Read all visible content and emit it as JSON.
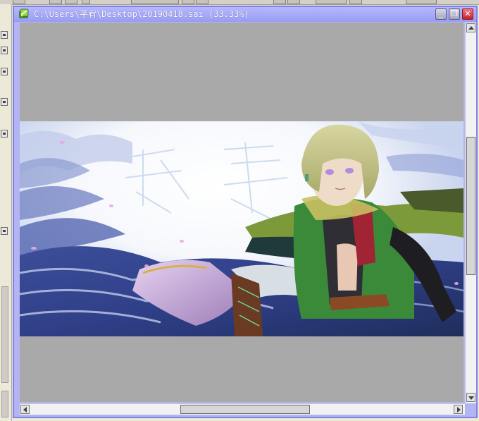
{
  "window": {
    "title": "C:\\Users\\芊宥\\Desktop\\20190418.sai (33.33%)",
    "minimize_glyph": "_",
    "restore_glyph": "❐",
    "close_glyph": "✕",
    "icon": "sai-app-icon"
  },
  "canvas": {
    "background": "#a9a9a9",
    "artwork_icon": "artwork-image"
  },
  "scrollbars": {
    "vertical_thumb_fraction": {
      "start": 0.3,
      "end": 0.68
    },
    "horizontal_thumb_fraction": {
      "start": 0.37,
      "end": 0.66
    }
  },
  "colors": {
    "title_bar": "#9a9cf2",
    "window_border": "#7e82e6",
    "close_button": "#c6202c"
  }
}
